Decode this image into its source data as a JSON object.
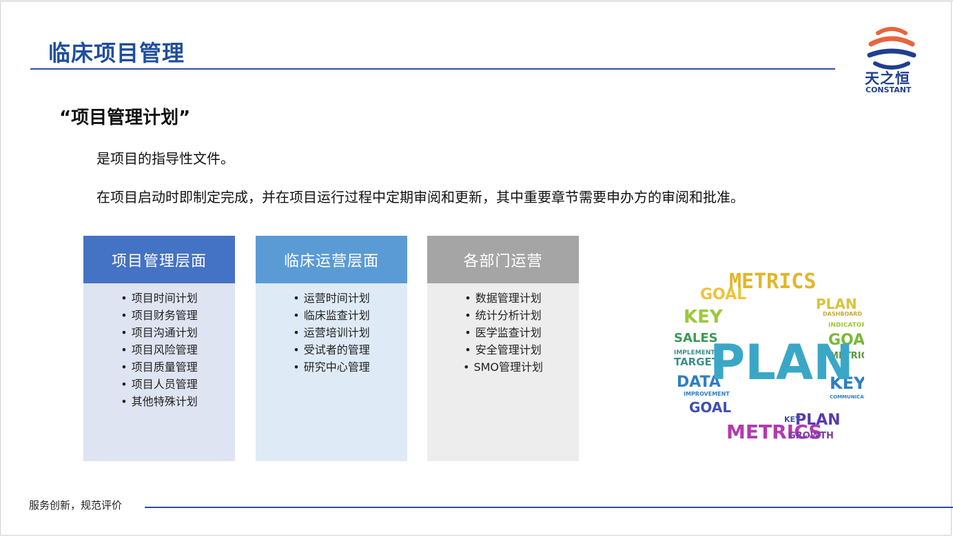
{
  "header": {
    "title": "临床项目管理",
    "logo_text": "天之恒",
    "logo_sub": "CONSTANT"
  },
  "section": {
    "heading": "“项目管理计划”",
    "paragraphs": [
      "是项目的指导性文件。",
      "在项目启动时即制定完成，并在项目运行过程中定期审阅和更新，其中重要章节需要申办方的审阅和批准。"
    ]
  },
  "cards": [
    {
      "title": "项目管理层面",
      "items": [
        "项目时间计划",
        "项目财务管理",
        "项目沟通计划",
        "项目风险管理",
        "项目质量管理",
        "项目人员管理",
        "其他特殊计划"
      ]
    },
    {
      "title": "临床运营层面",
      "items": [
        "运营时间计划",
        "临床监查计划",
        "运营培训计划",
        "受试者的管理",
        "研究中心管理"
      ]
    },
    {
      "title": "各部门运营",
      "items": [
        "数据管理计划",
        "统计分析计划",
        "医学监查计划",
        "安全管理计划",
        "SMO管理计划"
      ]
    }
  ],
  "bullet": "•",
  "wordcloud": {
    "center": "PLAN",
    "words": [
      "METRICS",
      "GOAL",
      "KEY",
      "SALES",
      "TARGET",
      "DATA",
      "PLAN",
      "GOAL",
      "KEY",
      "METRICS",
      "GOAL",
      "METRICS",
      "PLAN",
      "KEY",
      "GROWTH",
      "IMPLEMENT",
      "IMPROVEMENT",
      "INDICATOR",
      "DASHBOARD",
      "COMMUNICATION"
    ]
  },
  "footer": {
    "tagline": "服务创新，规范评价"
  },
  "colors": {
    "brand_blue": "#1f4e9c",
    "logo_orange": "#e8643c",
    "card1_head": "#4472c4",
    "card2_head": "#5b9bd5",
    "card3_head": "#a5a5a5",
    "plan_teal": "#3aa7c7"
  }
}
